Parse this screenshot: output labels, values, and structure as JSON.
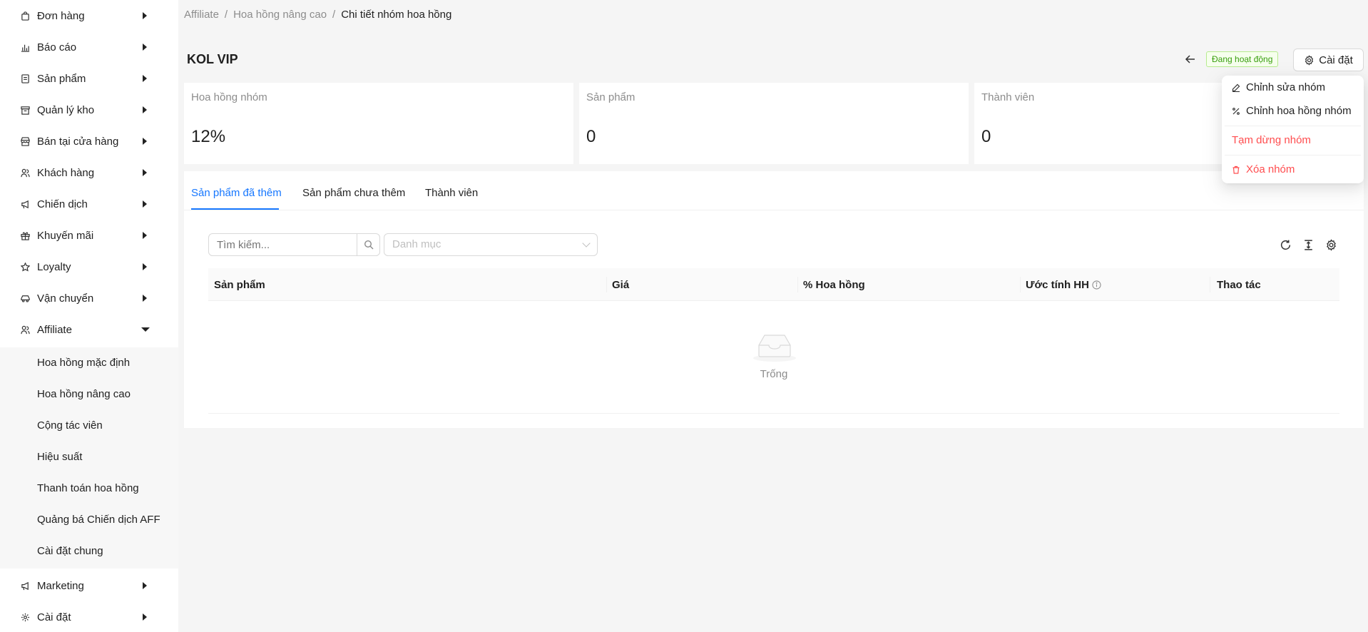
{
  "sidebar": {
    "items": [
      {
        "label": "Đơn hàng",
        "icon": "shopping-bag-icon"
      },
      {
        "label": "Báo cáo",
        "icon": "bar-chart-icon"
      },
      {
        "label": "Sản phẩm",
        "icon": "product-list-icon"
      },
      {
        "label": "Quản lý kho",
        "icon": "warehouse-box-icon"
      },
      {
        "label": "Bán tại cửa hàng",
        "icon": "store-icon"
      },
      {
        "label": "Khách hàng",
        "icon": "users-icon"
      },
      {
        "label": "Chiến dịch",
        "icon": "megaphone-icon"
      },
      {
        "label": "Khuyến mãi",
        "icon": "gift-icon"
      },
      {
        "label": "Loyalty",
        "icon": "star-icon"
      },
      {
        "label": "Vận chuyển",
        "icon": "car-icon"
      },
      {
        "label": "Affiliate",
        "icon": "users-icon"
      }
    ],
    "affiliate_sub": [
      "Hoa hồng mặc định",
      "Hoa hồng nâng cao",
      "Cộng tác viên",
      "Hiệu suất",
      "Thanh toán hoa hồng",
      "Quảng bá Chiến dịch AFF",
      "Cài đặt chung"
    ],
    "bottom_items": [
      {
        "label": "Marketing",
        "icon": "megaphone-icon"
      },
      {
        "label": "Cài đặt",
        "icon": "gear-icon"
      }
    ]
  },
  "breadcrumb": {
    "items": [
      "Affiliate",
      "Hoa hồng nâng cao",
      "Chi tiết nhóm hoa hồng"
    ],
    "separator": "/"
  },
  "header": {
    "title": "KOL VIP",
    "status": "Đang hoạt động",
    "settings_label": "Cài đặt"
  },
  "stats": [
    {
      "label": "Hoa hồng nhóm",
      "value": "12%"
    },
    {
      "label": "Sản phẩm",
      "value": "0"
    },
    {
      "label": "Thành viên",
      "value": "0"
    }
  ],
  "tabs": [
    {
      "label": "Sản phẩm đã thêm",
      "active": true
    },
    {
      "label": "Sản phẩm chưa thêm",
      "active": false
    },
    {
      "label": "Thành viên",
      "active": false
    }
  ],
  "filters": {
    "search_placeholder": "Tìm kiếm...",
    "category_placeholder": "Danh mục"
  },
  "table": {
    "columns": [
      "Sản phẩm",
      "Giá",
      "% Hoa hồng",
      "Ước tính HH",
      "Thao tác"
    ],
    "empty_text": "Trống"
  },
  "dropdown": {
    "items": [
      {
        "label": "Chỉnh sửa nhóm",
        "icon": "edit-icon",
        "danger": false
      },
      {
        "label": "Chỉnh hoa hồng nhóm",
        "icon": "percent-icon",
        "danger": false
      },
      {
        "label": "Tạm dừng nhóm",
        "icon": "",
        "danger": true
      },
      {
        "label": "Xóa nhóm",
        "icon": "trash-icon",
        "danger": true
      }
    ]
  },
  "colors": {
    "primary": "#1677ff",
    "success": "#389e0d",
    "danger": "#ff4d4f"
  }
}
